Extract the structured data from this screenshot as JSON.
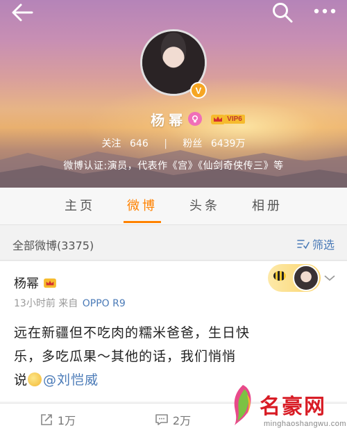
{
  "profile": {
    "name": "杨幂",
    "vip_label": "VIP6",
    "following_label": "关注",
    "following_count": "646",
    "followers_label": "粉丝",
    "followers_count": "6439万",
    "verification": "微博认证:演员，代表作《宫》《仙剑奇侠传三》等",
    "verified_badge": "V"
  },
  "tabs": [
    {
      "label": "主页",
      "active": false
    },
    {
      "label": "微博",
      "active": true
    },
    {
      "label": "头条",
      "active": false
    },
    {
      "label": "相册",
      "active": false
    }
  ],
  "filter": {
    "title": "全部微博(3375)",
    "button_label": "筛选"
  },
  "post": {
    "author": "杨幂",
    "time": "13小时前",
    "source_prefix": "来自",
    "source": "OPPO R9",
    "text_line1": "远在新疆但不吃肉的糯米爸爸，生日快",
    "text_line2": "乐，多吃瓜果～其他的话，我们悄悄",
    "text_line3_prefix": "说",
    "mention": "@刘恺威"
  },
  "actions": {
    "repost_count": "1万",
    "comment_count": "2万",
    "like_count": ""
  },
  "watermark": {
    "title": "名豪网",
    "url": "minghaoshangwu.com"
  },
  "colors": {
    "accent": "#ff8200",
    "link": "#4a7ab7",
    "vip_gold": "#f6bb2d"
  }
}
